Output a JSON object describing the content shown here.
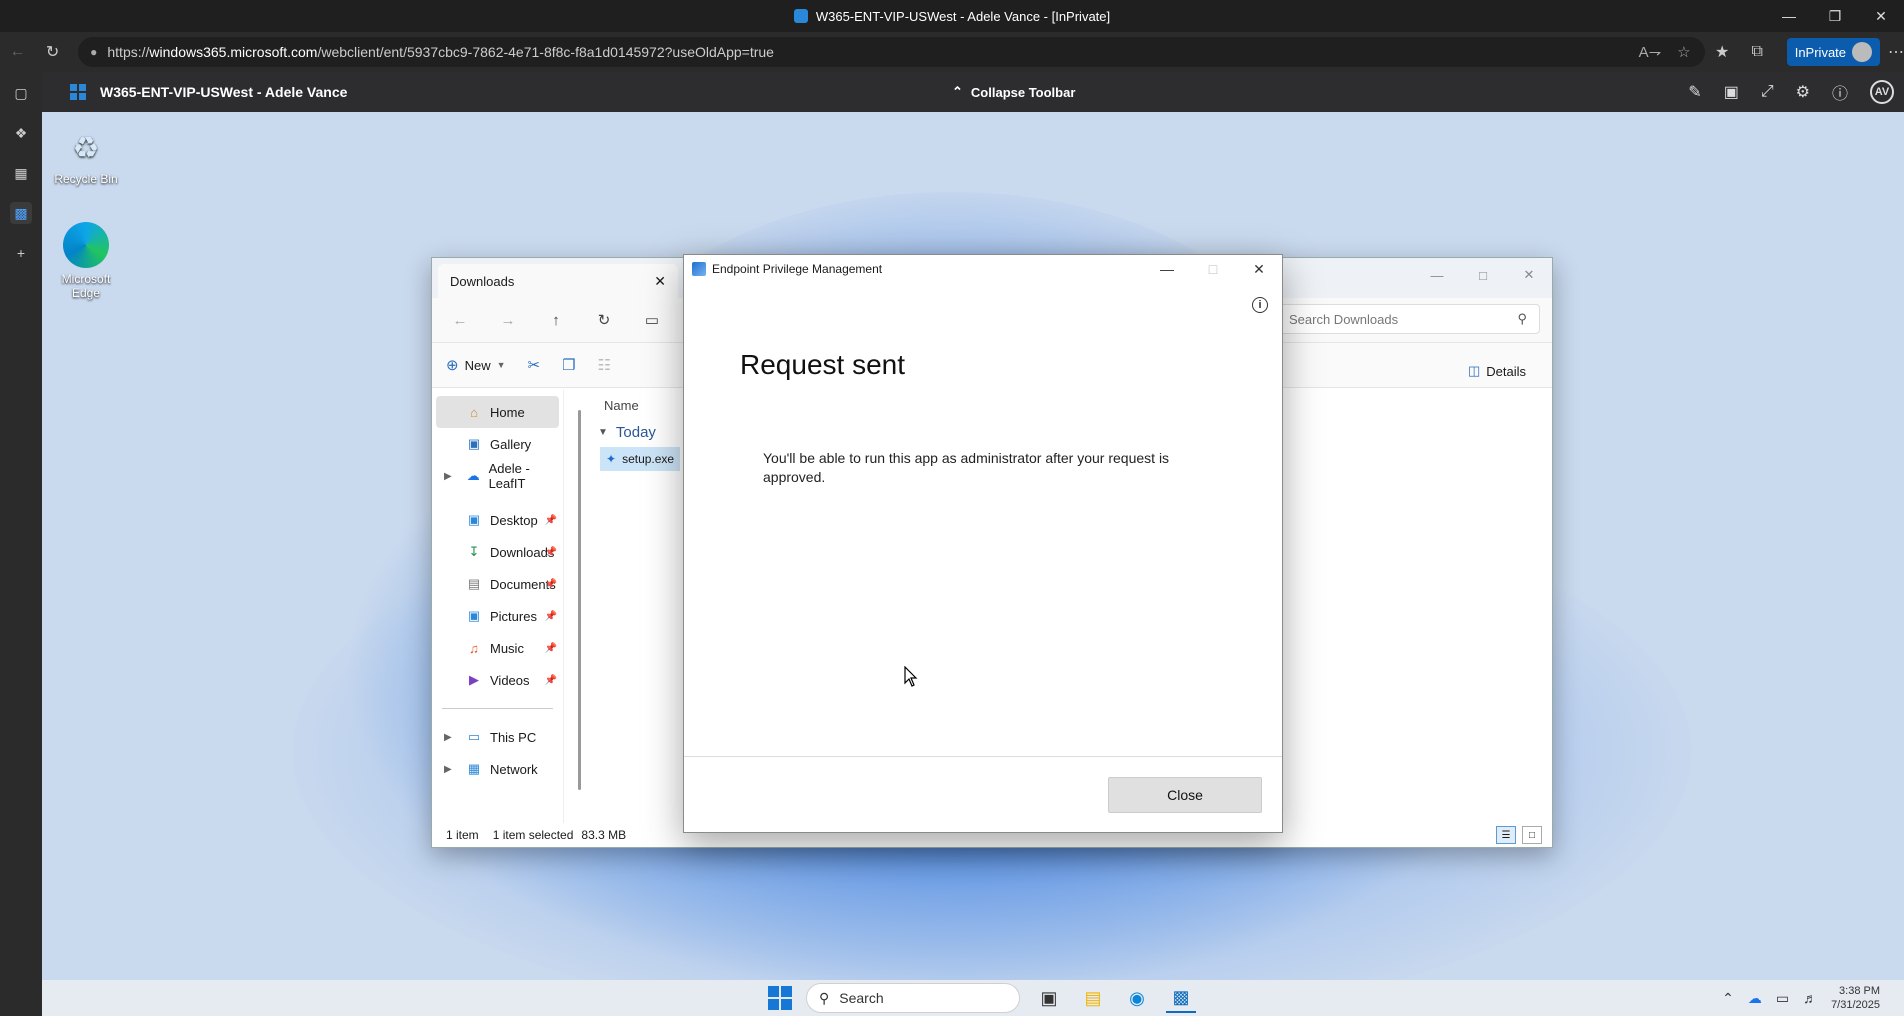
{
  "browser": {
    "window_title": "W365-ENT-VIP-USWest - Adele Vance - [InPrivate]",
    "url_prefix": "https://",
    "url_host": "windows365.microsoft.com",
    "url_path": "/webclient/ent/5937cbc9-7862-4e71-8f8c-f8a1d0145972?useOldApp=true",
    "inprivate_label": "InPrivate"
  },
  "w365": {
    "name": "W365-ENT-VIP-USWest - Adele Vance",
    "collapse_label": "Collapse Toolbar",
    "avatar_initials": "AV"
  },
  "desktop": {
    "icons": [
      {
        "label": "Recycle Bin"
      },
      {
        "label": "Microsoft Edge"
      }
    ]
  },
  "explorer": {
    "tab_title": "Downloads",
    "new_label": "New",
    "search_placeholder": "Search Downloads",
    "details_label": "Details",
    "column_name": "Name",
    "group_label": "Today",
    "file_name": "setup.exe",
    "nav": {
      "home": "Home",
      "gallery": "Gallery",
      "onedrive": "Adele - LeafIT",
      "desktop": "Desktop",
      "downloads": "Downloads",
      "documents": "Documents",
      "pictures": "Pictures",
      "music": "Music",
      "videos": "Videos",
      "thispc": "This PC",
      "network": "Network"
    },
    "status": {
      "items": "1 item",
      "selected": "1 item selected",
      "size": "83.3 MB"
    }
  },
  "epm_dialog": {
    "title": "Endpoint Privilege Management",
    "heading": "Request sent",
    "message": "You'll be able to run this app as administrator after your request is approved.",
    "close_label": "Close"
  },
  "taskbar": {
    "search_label": "Search",
    "time": "3:38 PM",
    "date": "7/31/2025"
  },
  "colors": {
    "accent": "#0f6cbd",
    "inprivate": "#0b5cad",
    "selection": "#cce4f7"
  }
}
